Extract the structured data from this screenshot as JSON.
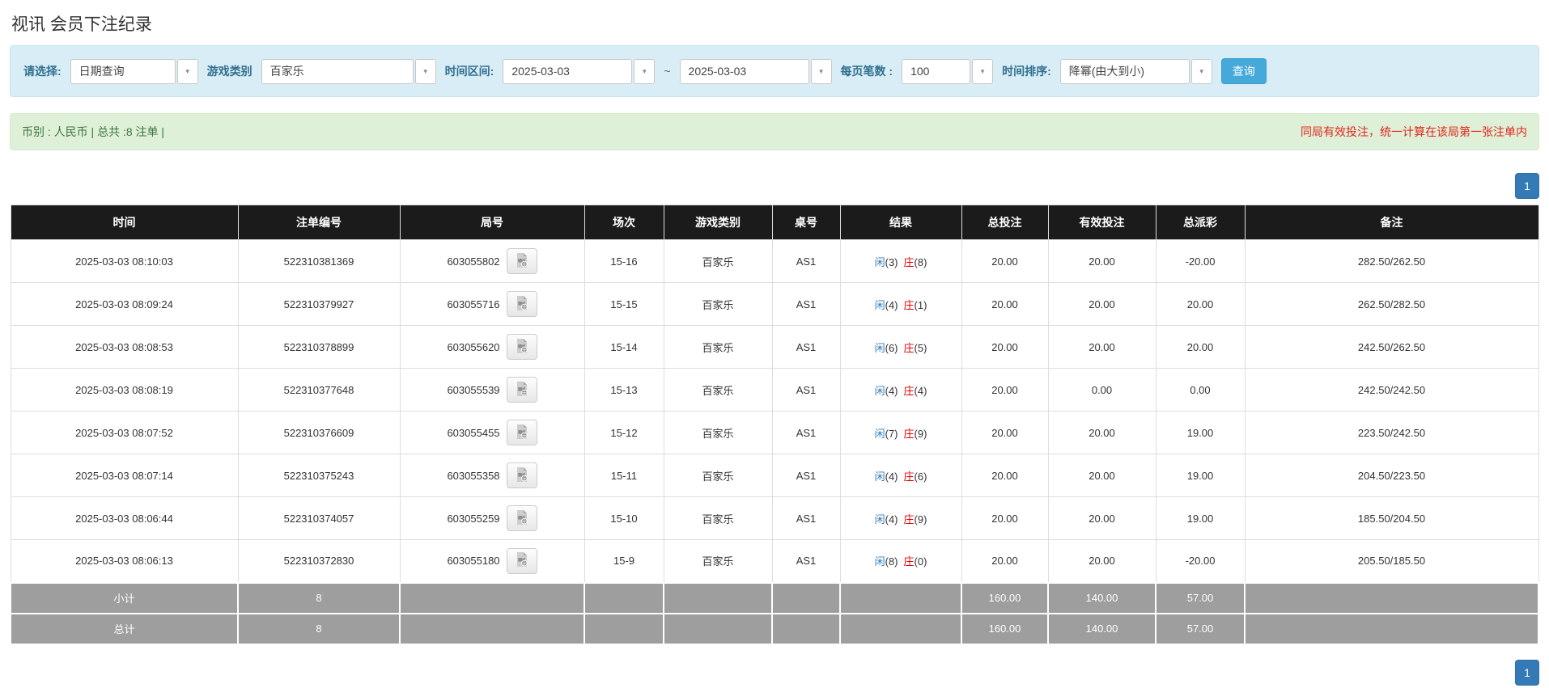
{
  "page": {
    "title": "视讯 会员下注纪录"
  },
  "filters": {
    "select_label": "请选择:",
    "select_value": "日期查询",
    "game_label": "游戏类别",
    "game_value": "百家乐",
    "range_label": "时间区间:",
    "date_from": "2025-03-03",
    "tilde": "~",
    "date_to": "2025-03-03",
    "page_size_label": "每页笔数 :",
    "page_size_value": "100",
    "sort_label": "时间排序:",
    "sort_value": "降幂(由大到小)",
    "search_button": "查询"
  },
  "notice": {
    "left": "币别 : 人民币 | 总共 :8 注单 |",
    "right": "同局有效投注，统一计算在该局第一张注单内"
  },
  "pagination": {
    "page": "1"
  },
  "table": {
    "headers": [
      "时间",
      "注单编号",
      "局号",
      "场次",
      "游戏类别",
      "桌号",
      "结果",
      "总投注",
      "有效投注",
      "总派彩",
      "备注"
    ],
    "rows": [
      {
        "time": "2025-03-03 08:10:03",
        "bet_no": "522310381369",
        "round_no": "603055802",
        "session": "15-16",
        "game": "百家乐",
        "table_no": "AS1",
        "result": {
          "p_label": "闲",
          "p_num": "(3)",
          "b_label": "庄",
          "b_num": "(8)"
        },
        "total_bet": "20.00",
        "valid_bet": "20.00",
        "payout": "-20.00",
        "remark": "282.50/262.50"
      },
      {
        "time": "2025-03-03 08:09:24",
        "bet_no": "522310379927",
        "round_no": "603055716",
        "session": "15-15",
        "game": "百家乐",
        "table_no": "AS1",
        "result": {
          "p_label": "闲",
          "p_num": "(4)",
          "b_label": "庄",
          "b_num": "(1)"
        },
        "total_bet": "20.00",
        "valid_bet": "20.00",
        "payout": "20.00",
        "remark": "262.50/282.50"
      },
      {
        "time": "2025-03-03 08:08:53",
        "bet_no": "522310378899",
        "round_no": "603055620",
        "session": "15-14",
        "game": "百家乐",
        "table_no": "AS1",
        "result": {
          "p_label": "闲",
          "p_num": "(6)",
          "b_label": "庄",
          "b_num": "(5)"
        },
        "total_bet": "20.00",
        "valid_bet": "20.00",
        "payout": "20.00",
        "remark": "242.50/262.50"
      },
      {
        "time": "2025-03-03 08:08:19",
        "bet_no": "522310377648",
        "round_no": "603055539",
        "session": "15-13",
        "game": "百家乐",
        "table_no": "AS1",
        "result": {
          "p_label": "闲",
          "p_num": "(4)",
          "b_label": "庄",
          "b_num": "(4)"
        },
        "total_bet": "20.00",
        "valid_bet": "0.00",
        "payout": "0.00",
        "remark": "242.50/242.50"
      },
      {
        "time": "2025-03-03 08:07:52",
        "bet_no": "522310376609",
        "round_no": "603055455",
        "session": "15-12",
        "game": "百家乐",
        "table_no": "AS1",
        "result": {
          "p_label": "闲",
          "p_num": "(7)",
          "b_label": "庄",
          "b_num": "(9)"
        },
        "total_bet": "20.00",
        "valid_bet": "20.00",
        "payout": "19.00",
        "remark": "223.50/242.50"
      },
      {
        "time": "2025-03-03 08:07:14",
        "bet_no": "522310375243",
        "round_no": "603055358",
        "session": "15-11",
        "game": "百家乐",
        "table_no": "AS1",
        "result": {
          "p_label": "闲",
          "p_num": "(4)",
          "b_label": "庄",
          "b_num": "(6)"
        },
        "total_bet": "20.00",
        "valid_bet": "20.00",
        "payout": "19.00",
        "remark": "204.50/223.50"
      },
      {
        "time": "2025-03-03 08:06:44",
        "bet_no": "522310374057",
        "round_no": "603055259",
        "session": "15-10",
        "game": "百家乐",
        "table_no": "AS1",
        "result": {
          "p_label": "闲",
          "p_num": "(4)",
          "b_label": "庄",
          "b_num": "(9)"
        },
        "total_bet": "20.00",
        "valid_bet": "20.00",
        "payout": "19.00",
        "remark": "185.50/204.50"
      },
      {
        "time": "2025-03-03 08:06:13",
        "bet_no": "522310372830",
        "round_no": "603055180",
        "session": "15-9",
        "game": "百家乐",
        "table_no": "AS1",
        "result": {
          "p_label": "闲",
          "p_num": "(8)",
          "b_label": "庄",
          "b_num": "(0)"
        },
        "total_bet": "20.00",
        "valid_bet": "20.00",
        "payout": "-20.00",
        "remark": "205.50/185.50"
      }
    ],
    "subtotal": {
      "label": "小计",
      "count": "8",
      "total_bet": "160.00",
      "valid_bet": "140.00",
      "payout": "57.00"
    },
    "total": {
      "label": "总计",
      "count": "8",
      "total_bet": "160.00",
      "valid_bet": "140.00",
      "payout": "57.00"
    }
  },
  "colors": {
    "accent_blue": "#337ab7",
    "result_player_blue": "#337ab7",
    "result_banker_red": "#e60000",
    "negative_red": "#e60000",
    "notice_red": "#e4251c",
    "filter_bar_bg": "#d9edf7",
    "filter_label": "#31708f",
    "notice_bar_bg": "#dff0d8",
    "notice_text_green": "#3c763d",
    "table_header_bg": "#1b1b1b",
    "summary_row_bg": "#9e9e9e",
    "search_button_bg": "#45a9da"
  }
}
